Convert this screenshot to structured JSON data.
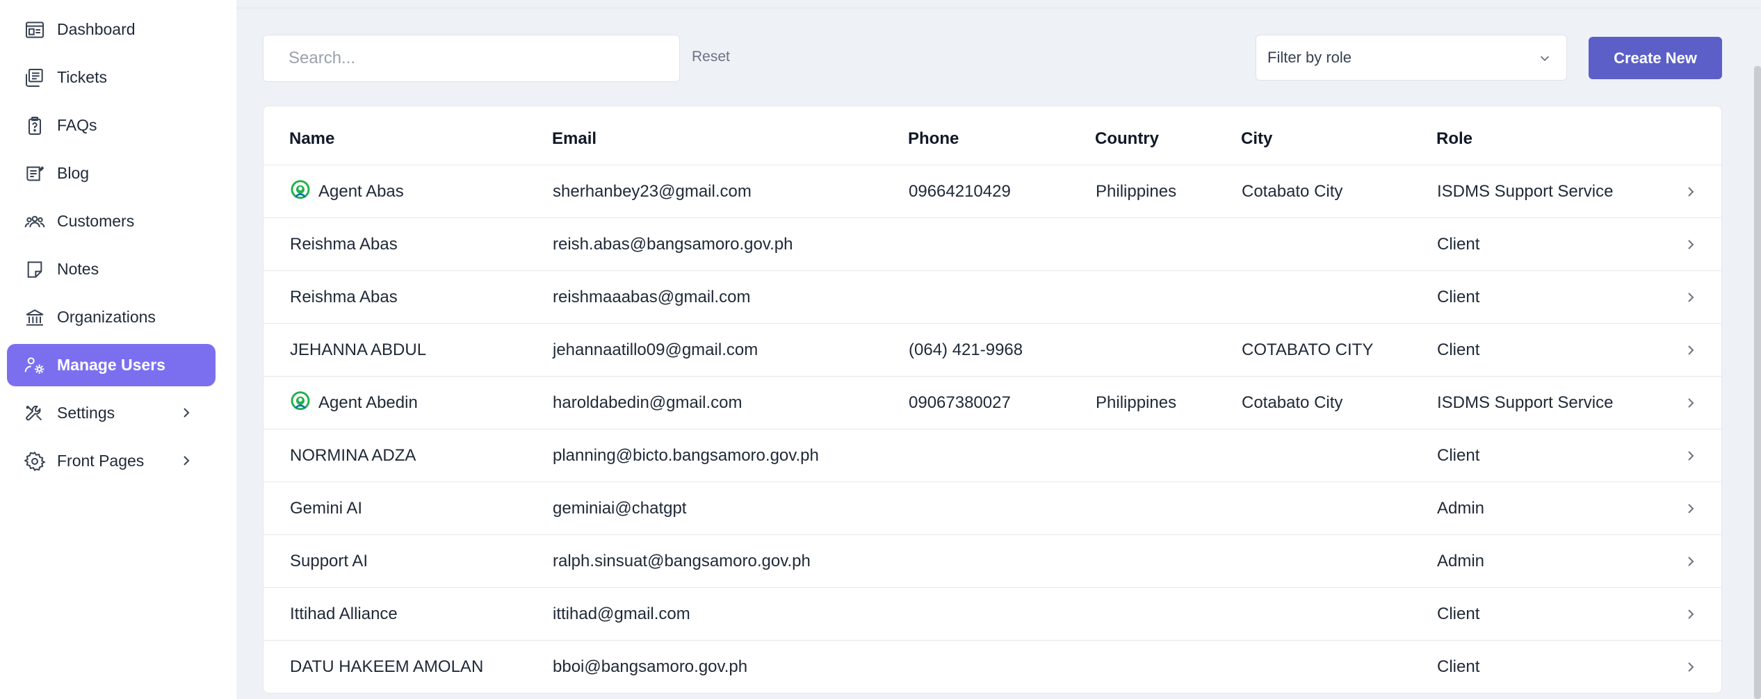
{
  "sidebar": {
    "items": [
      {
        "label": "Dashboard",
        "icon": "dashboard-icon"
      },
      {
        "label": "Tickets",
        "icon": "tickets-icon"
      },
      {
        "label": "FAQs",
        "icon": "faq-icon"
      },
      {
        "label": "Blog",
        "icon": "blog-icon"
      },
      {
        "label": "Customers",
        "icon": "customers-icon"
      },
      {
        "label": "Notes",
        "icon": "notes-icon"
      },
      {
        "label": "Organizations",
        "icon": "organizations-icon"
      },
      {
        "label": "Manage Users",
        "icon": "manage-users-icon",
        "active": true
      },
      {
        "label": "Settings",
        "icon": "settings-icon",
        "has_submenu": true
      },
      {
        "label": "Front Pages",
        "icon": "front-pages-icon",
        "has_submenu": true
      }
    ]
  },
  "toolbar": {
    "search_placeholder": "Search...",
    "search_value": "",
    "reset_label": "Reset",
    "filter_label": "Filter by role",
    "create_label": "Create New"
  },
  "table": {
    "headers": {
      "name": "Name",
      "email": "Email",
      "phone": "Phone",
      "country": "Country",
      "city": "City",
      "role": "Role"
    },
    "rows": [
      {
        "name": "Agent Abas",
        "agent": true,
        "email": "sherhanbey23@gmail.com",
        "phone": "09664210429",
        "country": "Philippines",
        "city": "Cotabato City",
        "role": "ISDMS Support Service"
      },
      {
        "name": "Reishma Abas",
        "agent": false,
        "email": "reish.abas@bangsamoro.gov.ph",
        "phone": "",
        "country": "",
        "city": "",
        "role": "Client"
      },
      {
        "name": "Reishma Abas",
        "agent": false,
        "email": "reishmaaabas@gmail.com",
        "phone": "",
        "country": "",
        "city": "",
        "role": "Client"
      },
      {
        "name": "JEHANNA ABDUL",
        "agent": false,
        "email": "jehannaatillo09@gmail.com",
        "phone": "(064) 421-9968",
        "country": "",
        "city": "COTABATO CITY",
        "role": "Client"
      },
      {
        "name": "Agent Abedin",
        "agent": true,
        "email": "haroldabedin@gmail.com",
        "phone": "09067380027",
        "country": "Philippines",
        "city": "Cotabato City",
        "role": "ISDMS Support Service"
      },
      {
        "name": "NORMINA ADZA",
        "agent": false,
        "email": "planning@bicto.bangsamoro.gov.ph",
        "phone": "",
        "country": "",
        "city": "",
        "role": "Client"
      },
      {
        "name": "Gemini AI",
        "agent": false,
        "email": "geminiai@chatgpt",
        "phone": "",
        "country": "",
        "city": "",
        "role": "Admin"
      },
      {
        "name": "Support AI",
        "agent": false,
        "email": "ralph.sinsuat@bangsamoro.gov.ph",
        "phone": "",
        "country": "",
        "city": "",
        "role": "Admin"
      },
      {
        "name": "Ittihad Alliance",
        "agent": false,
        "email": "ittihad@gmail.com",
        "phone": "",
        "country": "",
        "city": "",
        "role": "Client"
      },
      {
        "name": "DATU HAKEEM AMOLAN",
        "agent": false,
        "email": "bboi@bangsamoro.gov.ph",
        "phone": "",
        "country": "",
        "city": "",
        "role": "Client"
      }
    ]
  },
  "colors": {
    "accent": "#7b6ff0",
    "button": "#5b5fc7",
    "agent_icon": "#22b14c"
  }
}
